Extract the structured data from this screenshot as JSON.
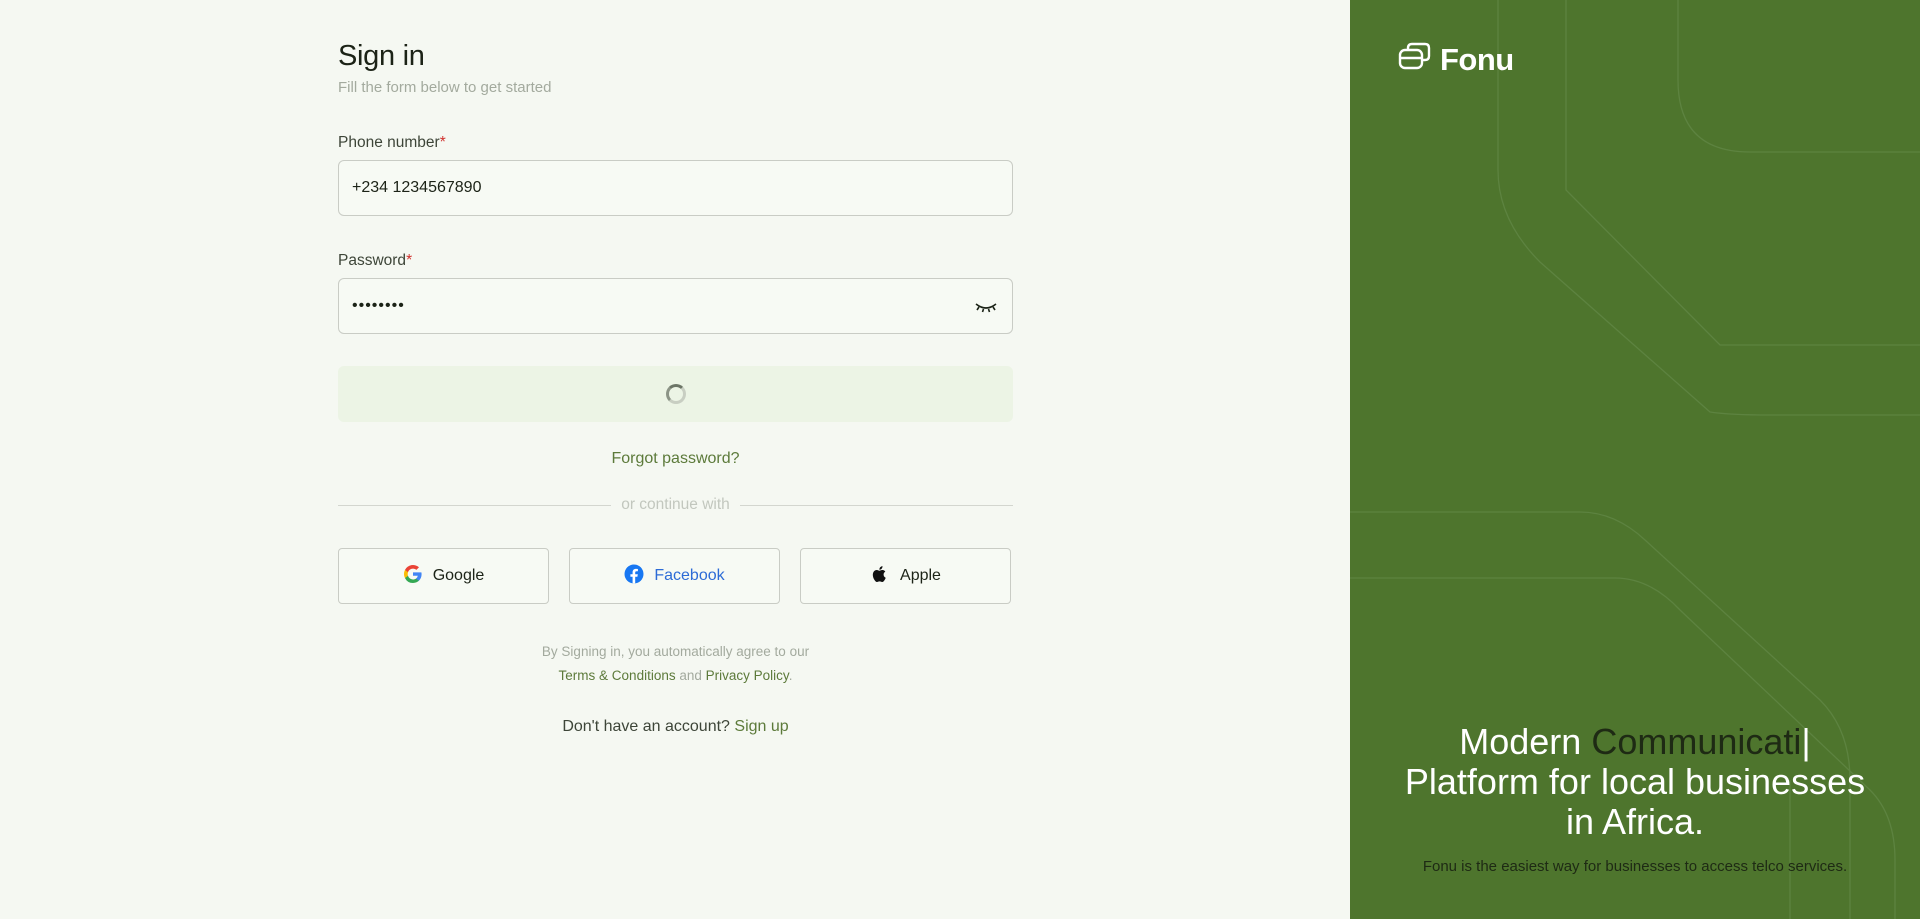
{
  "signin": {
    "title": "Sign in",
    "subtitle": "Fill the form below to get started",
    "phone_label": "Phone number",
    "phone_value": "+234 1234567890",
    "password_label": "Password",
    "password_value": "••••••••",
    "required_mark": "*",
    "forgot": "Forgot password?",
    "divider": "or continue with",
    "social": {
      "google": "Google",
      "facebook": "Facebook",
      "apple": "Apple"
    },
    "terms_line1": "By Signing in, you automatically agree to our",
    "terms_link": "Terms & Conditions",
    "terms_and": "and",
    "privacy_link": "Privacy Policy",
    "terms_end": ".",
    "no_account": "Don't have an account?",
    "signup": "Sign up"
  },
  "promo": {
    "brand": "Fonu",
    "headline_prefix": "Modern ",
    "headline_typing": "Communicati",
    "headline_caret": "|",
    "headline_line2": "Platform for local businesses",
    "headline_line3": "in Africa.",
    "tagline": "Fonu is the easiest way for businesses to access telco services."
  },
  "colors": {
    "accent": "#5c7a3a",
    "panel": "#4e752d",
    "background": "#f5f8f2"
  },
  "icons": {
    "eye": "eye-closed-icon",
    "spinner": "loading-spinner-icon",
    "google": "google-icon",
    "facebook": "facebook-icon",
    "apple": "apple-icon",
    "logo": "fonu-logo-icon"
  }
}
